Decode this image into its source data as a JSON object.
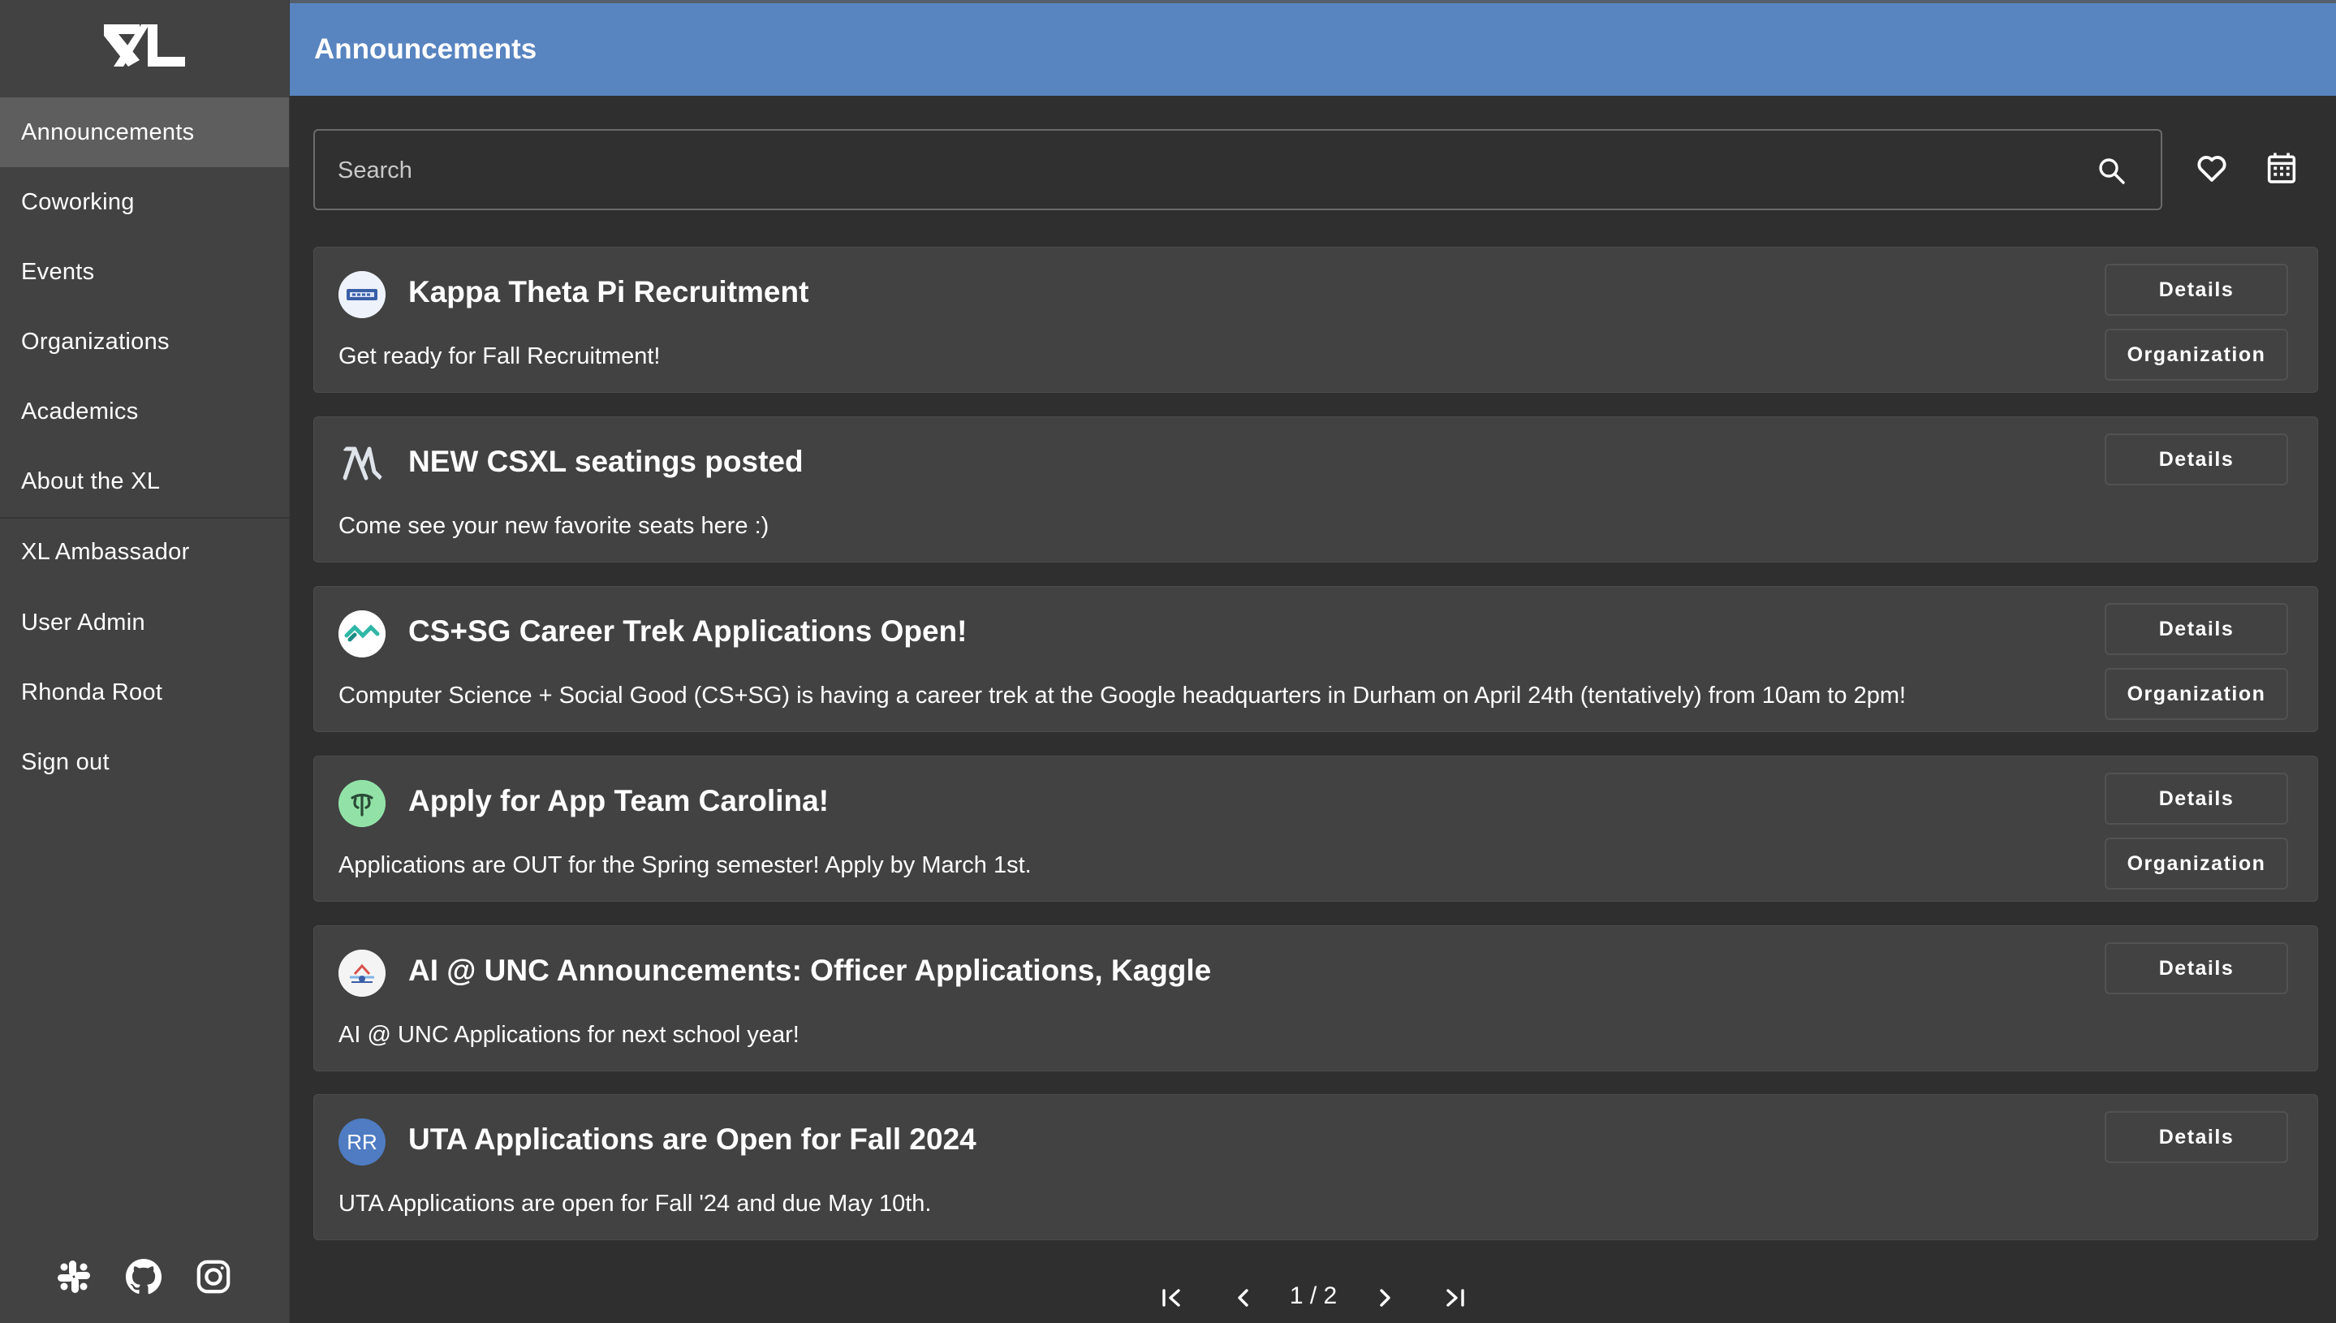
{
  "app": {
    "logo_text": "XL"
  },
  "sidebar": {
    "items": [
      {
        "label": "Announcements",
        "active": true
      },
      {
        "label": "Coworking"
      },
      {
        "label": "Events"
      },
      {
        "label": "Organizations"
      },
      {
        "label": "Academics"
      },
      {
        "label": "About the XL"
      },
      {
        "label": "XL Ambassador"
      },
      {
        "label": "User Admin"
      },
      {
        "label": "Rhonda Root"
      },
      {
        "label": "Sign out"
      }
    ],
    "social_icons": [
      "slack-icon",
      "github-icon",
      "instagram-icon"
    ]
  },
  "header": {
    "title": "Announcements",
    "color": "#5884c0"
  },
  "search": {
    "placeholder": "Search",
    "value": ""
  },
  "toolbar_icons": [
    "heart-icon",
    "calendar-icon"
  ],
  "announcements": [
    {
      "title": "Kappa Theta Pi Recruitment",
      "text": "Get ready for Fall Recruitment!",
      "details_label": "Details",
      "organization_label": "Organization",
      "avatar": "kappa-theta-pi-logo"
    },
    {
      "title": "NEW CSXL seatings posted",
      "text": "Come see your new favorite seats here :)",
      "details_label": "Details",
      "avatar": "xl-logo"
    },
    {
      "title": "CS+SG Career Trek Applications Open!",
      "text": "Computer Science + Social Good (CS+SG) is having a career trek at the Google headquarters in Durham on April 24th (tentatively) from 10am to 2pm!",
      "details_label": "Details",
      "organization_label": "Organization",
      "avatar": "cssg-logo"
    },
    {
      "title": "Apply for App Team Carolina!",
      "text": "Applications are OUT for the Spring semester! Apply by March 1st.",
      "details_label": "Details",
      "organization_label": "Organization",
      "avatar": "app-team-logo"
    },
    {
      "title": "AI @ UNC Announcements: Officer Applications, Kaggle",
      "text": "AI @ UNC Applications for next school year!",
      "details_label": "Details",
      "avatar": "ai-unc-logo"
    },
    {
      "title": "UTA Applications are Open for Fall 2024",
      "text": "UTA Applications are open for Fall '24 and due May 10th.",
      "details_label": "Details",
      "avatar": "initials-avatar",
      "avatar_initials": "RR"
    }
  ],
  "pagination": {
    "label": "1 / 2",
    "current": 1,
    "total": 2
  }
}
